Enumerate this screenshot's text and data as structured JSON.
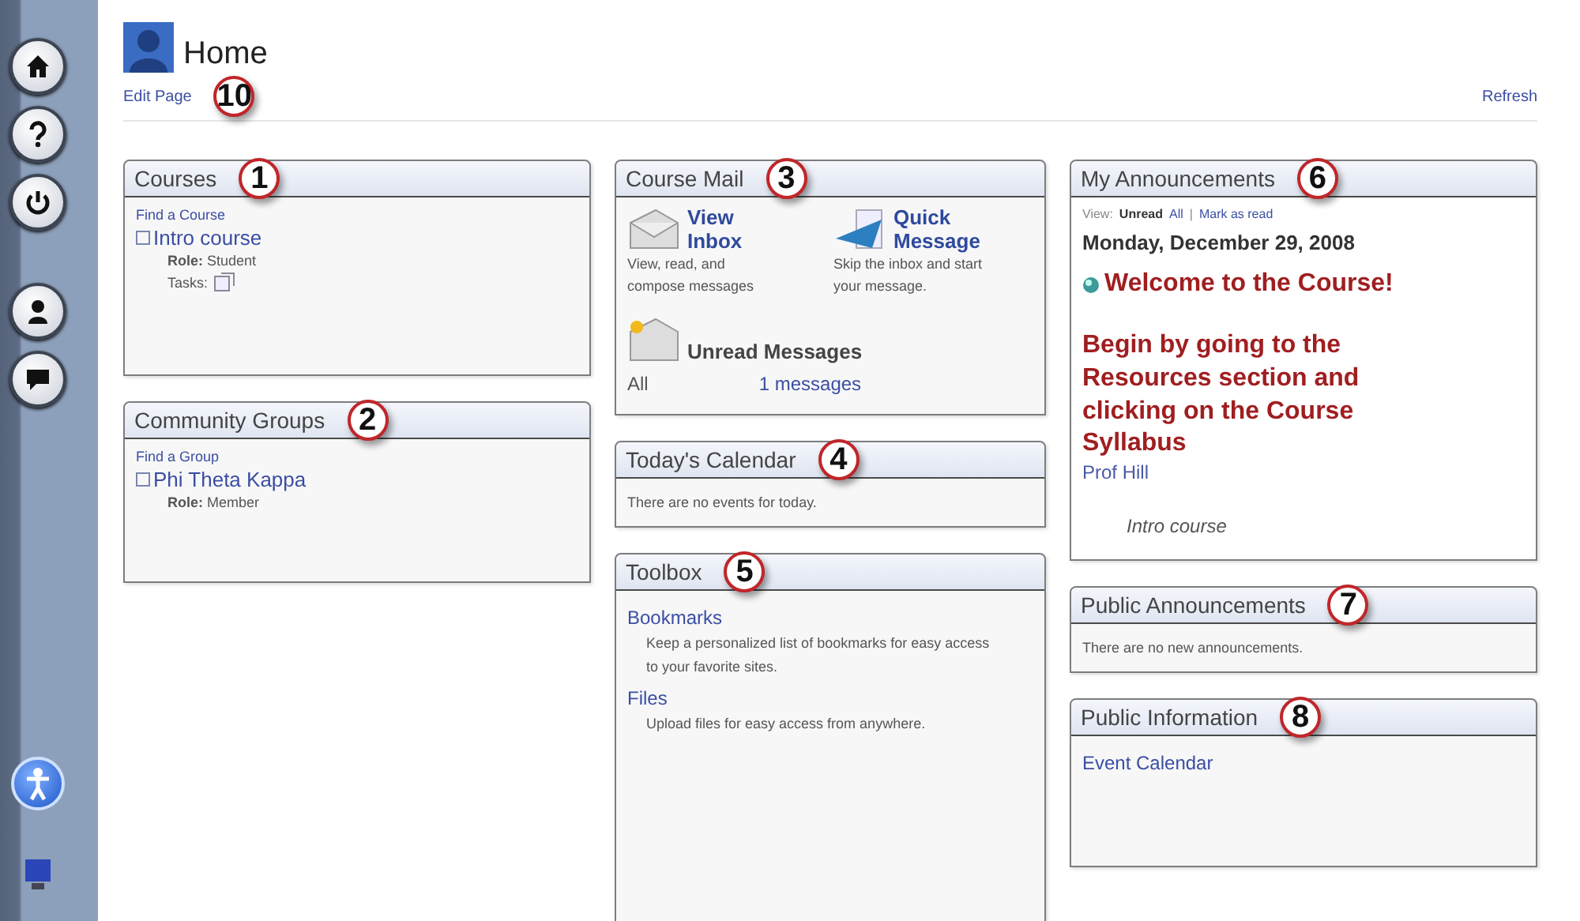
{
  "page": {
    "title": "Home",
    "edit_link": "Edit Page",
    "edit_callout": "10",
    "refresh": "Refresh"
  },
  "columns": [
    [
      {
        "kind": "enrolment",
        "title": "Courses",
        "callout": "1",
        "find_link": "Find a Course",
        "items": [
          {
            "name": "Intro course",
            "role": "**Role:** Student",
            "tasks_label": "Tasks:"
          }
        ]
      },
      {
        "kind": "enrolment",
        "title": "Community Groups",
        "callout": "2",
        "find_link": "Find a Group",
        "items": [
          {
            "name": "Phi Theta Kappa",
            "role": "**Role:** Member"
          }
        ]
      }
    ],
    [
      {
        "kind": "mail",
        "title": "Course Mail",
        "callout": "3",
        "actions": [
          {
            "title": "View Inbox",
            "description": "View, read, and compose messages"
          },
          {
            "title": "Quick Message",
            "description": "Skip the inbox and start your message."
          }
        ],
        "unread_title": "Unread Messages",
        "unread_rows": [
          {
            "label": "All",
            "count": "1 messages"
          }
        ]
      },
      {
        "kind": "message",
        "title": "Today's Calendar",
        "callout": "4",
        "message": "There are no events for today."
      },
      {
        "kind": "toolbox",
        "title": "Toolbox",
        "callout": "5",
        "items": [
          {
            "name": "Bookmarks",
            "description": "Keep a personalized list of bookmarks for easy access to your favorite sites."
          },
          {
            "name": "Files",
            "description": "Upload files for easy access from anywhere."
          }
        ]
      }
    ],
    [
      {
        "kind": "announcements",
        "title": "My Announcements",
        "callout": "6",
        "view_label": "View:",
        "filters": [
          {
            "label": "Unread",
            "selected": true
          },
          {
            "label": "All",
            "selected": false
          }
        ],
        "separator": "|",
        "mark_read": "Mark as read",
        "date": "Monday, December 29, 2008",
        "headline": "Welcome to the Course!",
        "body": "Begin by going to the Resources section and clicking on the Course Syllabus",
        "author": "Prof Hill",
        "course": "Intro course"
      },
      {
        "kind": "message",
        "title": "Public Announcements",
        "callout": "7",
        "message": "There are no new announcements."
      },
      {
        "kind": "links",
        "title": "Public Information",
        "callout": "8",
        "items": [
          "Event Calendar"
        ]
      }
    ]
  ]
}
